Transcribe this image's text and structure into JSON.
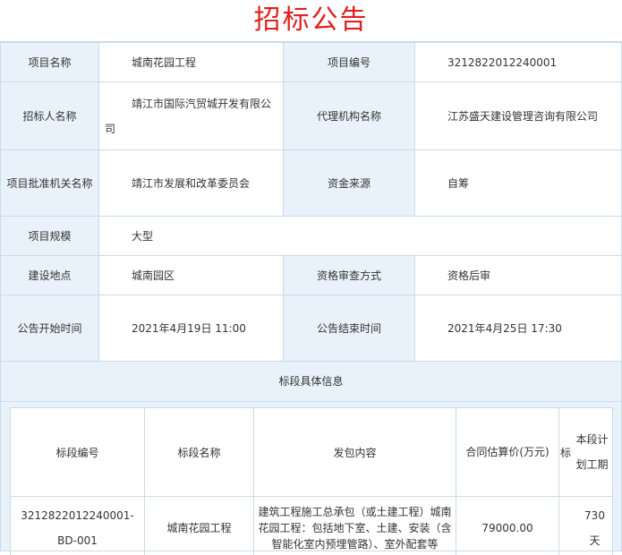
{
  "title": "招标公告",
  "rows": [
    {
      "l1": "项目名称",
      "v1": "城南花园工程",
      "l2": "项目编号",
      "v2": "3212822012240001"
    },
    {
      "l1": "招标人名称",
      "v1": "靖江市国际汽贸城开发有限公司",
      "l2": "代理机构名称",
      "v2": "江苏盛天建设管理咨询有限公司"
    },
    {
      "l1": "项目批准机关名称",
      "v1": "靖江市发展和改革委员会",
      "l2": "资金来源",
      "v2": "自筹"
    },
    {
      "l1": "项目规模",
      "v1": "大型"
    },
    {
      "l1": "建设地点",
      "v1": "城南园区",
      "l2": "资格审查方式",
      "v2": "资格后审"
    },
    {
      "l1": "公告开始时间",
      "v1": "2021年4月19日 11:00",
      "l2": "公告结束时间",
      "v2": "2021年4月25日 17:30"
    }
  ],
  "section_title": "标段具体信息",
  "lots": {
    "headers": [
      "标段编号",
      "标段名称",
      "发包内容",
      "合同估算价(万元)",
      "标",
      "本段计划工期"
    ],
    "rows": [
      {
        "code": "3212822012240001-BD-001",
        "name": "城南花园工程",
        "content": "建筑工程施工总承包（或土建工程）城南花园工程：包括地下室、土建、安装（含智能化室内预埋管路）、室外配套等",
        "price": "79000.00",
        "period": "730天"
      }
    ]
  }
}
